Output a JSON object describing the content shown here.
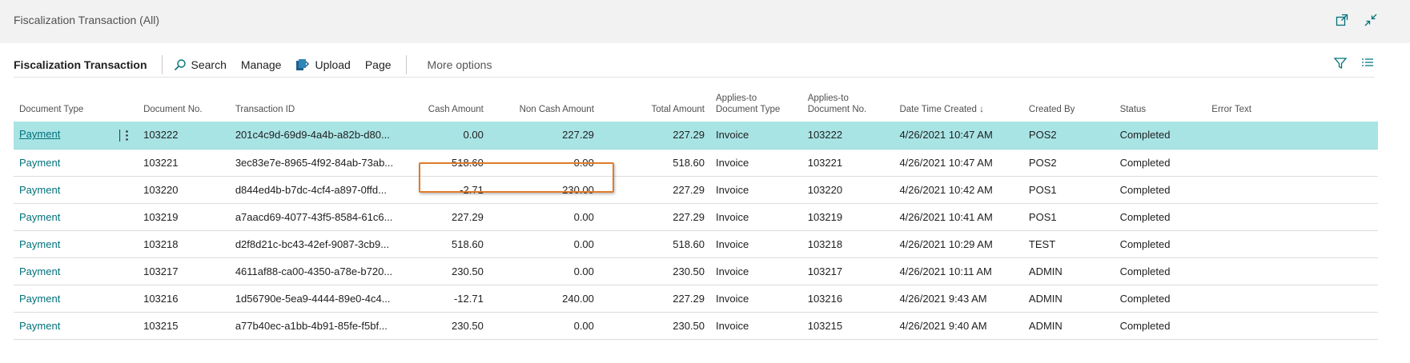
{
  "window": {
    "title": "Fiscalization Transaction (All)",
    "icons": [
      "open-new-window-icon",
      "collapse-icon"
    ]
  },
  "actionbar": {
    "title": "Fiscalization Transaction",
    "search_label": "Search",
    "manage_label": "Manage",
    "upload_label": "Upload",
    "page_label": "Page",
    "more_label": "More options",
    "right_icons": [
      "filter-icon",
      "list-view-icon"
    ]
  },
  "table": {
    "headers": {
      "document_type": "Document Type",
      "document_no": "Document No.",
      "transaction_id": "Transaction ID",
      "cash_amount": "Cash Amount",
      "non_cash_amount": "Non Cash Amount",
      "total_amount": "Total Amount",
      "applies_to_type_1": "Applies-to",
      "applies_to_type_2": "Document Type",
      "applies_to_no_1": "Applies-to",
      "applies_to_no_2": "Document No.",
      "date_time_created": "Date Time Created ↓",
      "created_by": "Created By",
      "status": "Status",
      "error_text": "Error Text"
    },
    "rows": [
      {
        "document_type": "Payment",
        "document_no": "103222",
        "transaction_id": "201c4c9d-69d9-4a4b-a82b-d80...",
        "cash_amount": "0.00",
        "non_cash_amount": "227.29",
        "total_amount": "227.29",
        "applies_to_type": "Invoice",
        "applies_to_no": "103222",
        "date_time": "4/26/2021 10:47 AM",
        "created_by": "POS2",
        "status": "Completed",
        "error_text": ""
      },
      {
        "document_type": "Payment",
        "document_no": "103221",
        "transaction_id": "3ec83e7e-8965-4f92-84ab-73ab...",
        "cash_amount": "518.60",
        "non_cash_amount": "0.00",
        "total_amount": "518.60",
        "applies_to_type": "Invoice",
        "applies_to_no": "103221",
        "date_time": "4/26/2021 10:47 AM",
        "created_by": "POS2",
        "status": "Completed",
        "error_text": ""
      },
      {
        "document_type": "Payment",
        "document_no": "103220",
        "transaction_id": "d844ed4b-b7dc-4cf4-a897-0ffd...",
        "cash_amount": "-2.71",
        "non_cash_amount": "230.00",
        "total_amount": "227.29",
        "applies_to_type": "Invoice",
        "applies_to_no": "103220",
        "date_time": "4/26/2021 10:42 AM",
        "created_by": "POS1",
        "status": "Completed",
        "error_text": ""
      },
      {
        "document_type": "Payment",
        "document_no": "103219",
        "transaction_id": "a7aacd69-4077-43f5-8584-61c6...",
        "cash_amount": "227.29",
        "non_cash_amount": "0.00",
        "total_amount": "227.29",
        "applies_to_type": "Invoice",
        "applies_to_no": "103219",
        "date_time": "4/26/2021 10:41 AM",
        "created_by": "POS1",
        "status": "Completed",
        "error_text": ""
      },
      {
        "document_type": "Payment",
        "document_no": "103218",
        "transaction_id": "d2f8d21c-bc43-42ef-9087-3cb9...",
        "cash_amount": "518.60",
        "non_cash_amount": "0.00",
        "total_amount": "518.60",
        "applies_to_type": "Invoice",
        "applies_to_no": "103218",
        "date_time": "4/26/2021 10:29 AM",
        "created_by": "TEST",
        "status": "Completed",
        "error_text": ""
      },
      {
        "document_type": "Payment",
        "document_no": "103217",
        "transaction_id": "4611af88-ca00-4350-a78e-b720...",
        "cash_amount": "230.50",
        "non_cash_amount": "0.00",
        "total_amount": "230.50",
        "applies_to_type": "Invoice",
        "applies_to_no": "103217",
        "date_time": "4/26/2021 10:11 AM",
        "created_by": "ADMIN",
        "status": "Completed",
        "error_text": ""
      },
      {
        "document_type": "Payment",
        "document_no": "103216",
        "transaction_id": "1d56790e-5ea9-4444-89e0-4c4...",
        "cash_amount": "-12.71",
        "non_cash_amount": "240.00",
        "total_amount": "227.29",
        "applies_to_type": "Invoice",
        "applies_to_no": "103216",
        "date_time": "4/26/2021 9:43 AM",
        "created_by": "ADMIN",
        "status": "Completed",
        "error_text": ""
      },
      {
        "document_type": "Payment",
        "document_no": "103215",
        "transaction_id": "a77b40ec-a1bb-4b91-85fe-f5bf...",
        "cash_amount": "230.50",
        "non_cash_amount": "0.00",
        "total_amount": "230.50",
        "applies_to_type": "Invoice",
        "applies_to_no": "103215",
        "date_time": "4/26/2021 9:40 AM",
        "created_by": "ADMIN",
        "status": "Completed",
        "error_text": ""
      }
    ],
    "selected_row": 0
  },
  "colors": {
    "accent": "#00717a",
    "selected_row": "#a9e4e5",
    "highlight_box": "#e07b2a"
  }
}
